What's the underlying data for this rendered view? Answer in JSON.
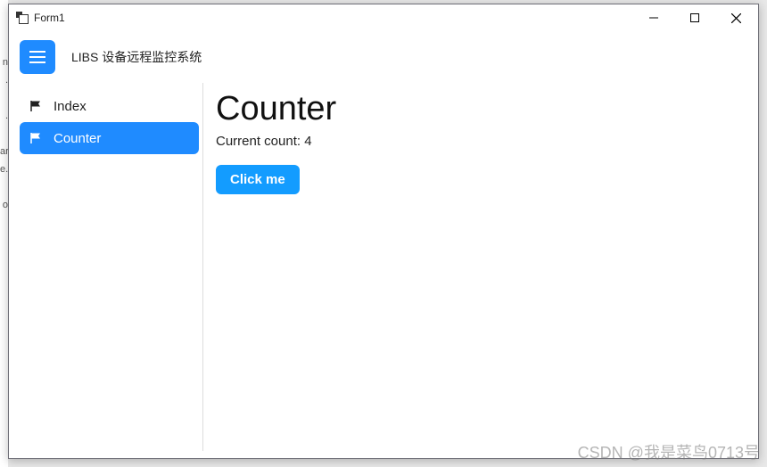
{
  "window": {
    "title": "Form1"
  },
  "header": {
    "app_title": "LIBS 设备远程监控系统"
  },
  "sidebar": {
    "items": [
      {
        "label": "Index",
        "active": false
      },
      {
        "label": "Counter",
        "active": true
      }
    ]
  },
  "content": {
    "heading": "Counter",
    "count_label": "Current count: ",
    "count_value": 4,
    "button_label": "Click me"
  },
  "watermark": "CSDN @我是菜鸟0713号"
}
